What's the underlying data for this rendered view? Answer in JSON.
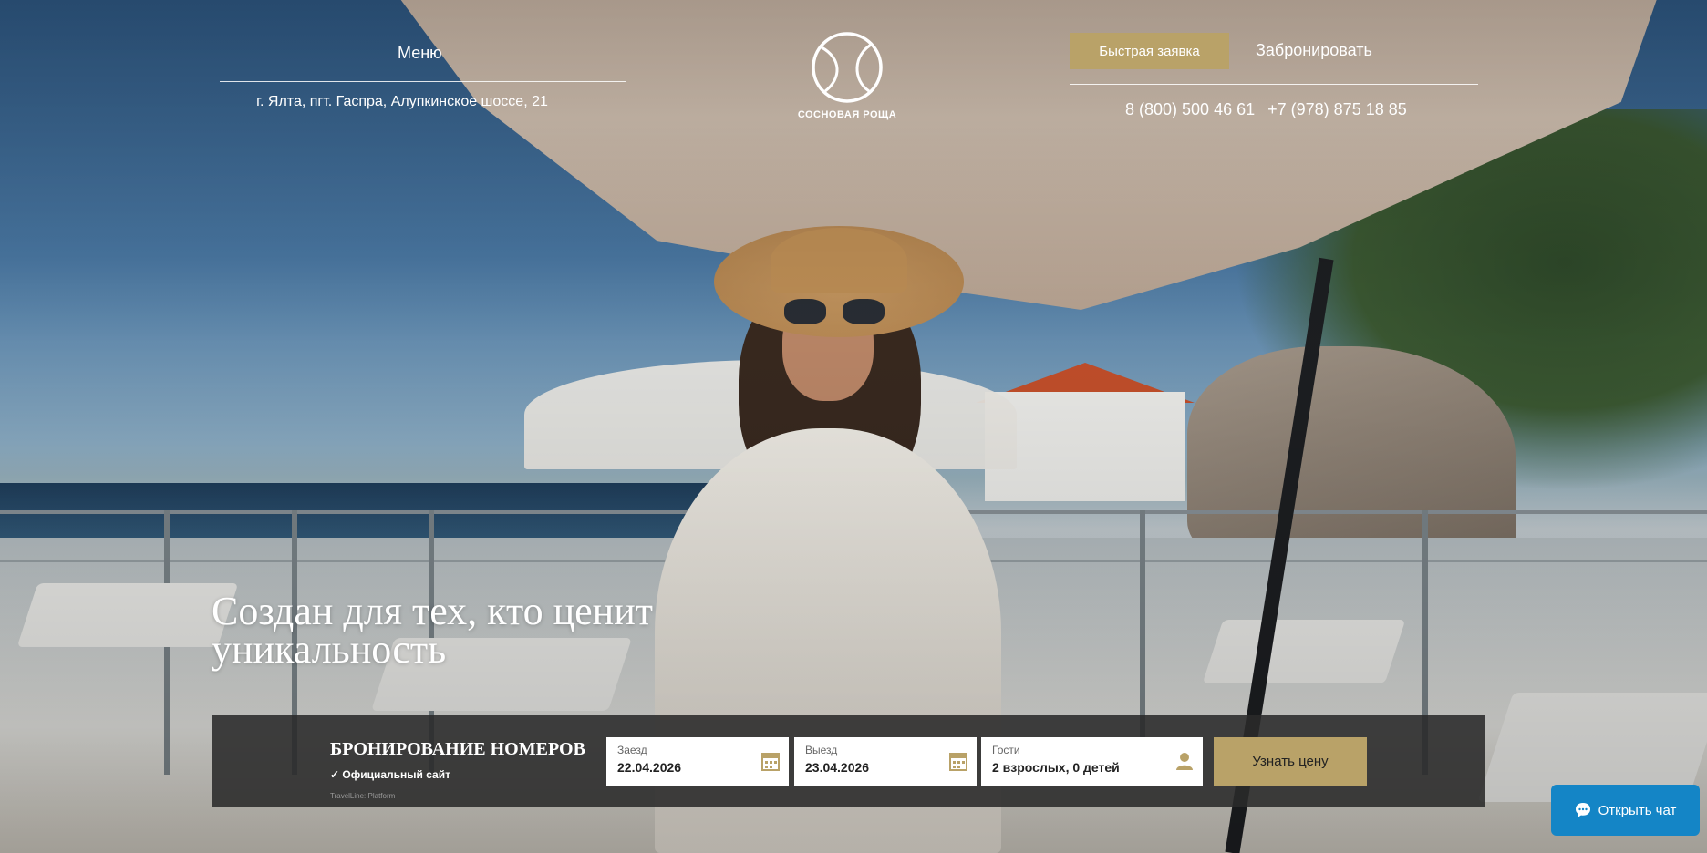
{
  "header": {
    "menu_label": "Меню",
    "address": "г. Ялта, пгт. Гаспра, Алупкинское шоссе, 21",
    "logo_text": "СОСНОВАЯ РОЩА",
    "quick_request_label": "Быстрая заявка",
    "book_label": "Забронировать",
    "phone_1": "8 (800) 500 46 61",
    "phone_2": "+7 (978) 875 18 85"
  },
  "hero": {
    "title_line_1": "Создан для тех, кто ценит",
    "title_line_2": "уникальность"
  },
  "booking": {
    "title": "БРОНИРОВАНИЕ НОМЕРОВ",
    "official": "✓ Официальный сайт",
    "platform": "TravelLine: Platform",
    "checkin_label": "Заезд",
    "checkin_value": "22.04.2026",
    "checkout_label": "Выезд",
    "checkout_value": "23.04.2026",
    "guests_label": "Гости",
    "guests_value": "2 взрослых, 0 детей",
    "submit_label": "Узнать цену"
  },
  "chat": {
    "label": "Открыть чат"
  },
  "icons": {
    "calendar": "calendar-icon",
    "guest": "person-icon",
    "chat": "chat-bubble-icon",
    "logo": "tennis-ball-logo"
  },
  "colors": {
    "accent_gold": "#b9a268",
    "booking_bar": "#2a2a2a",
    "chat_blue": "#1485c6"
  }
}
